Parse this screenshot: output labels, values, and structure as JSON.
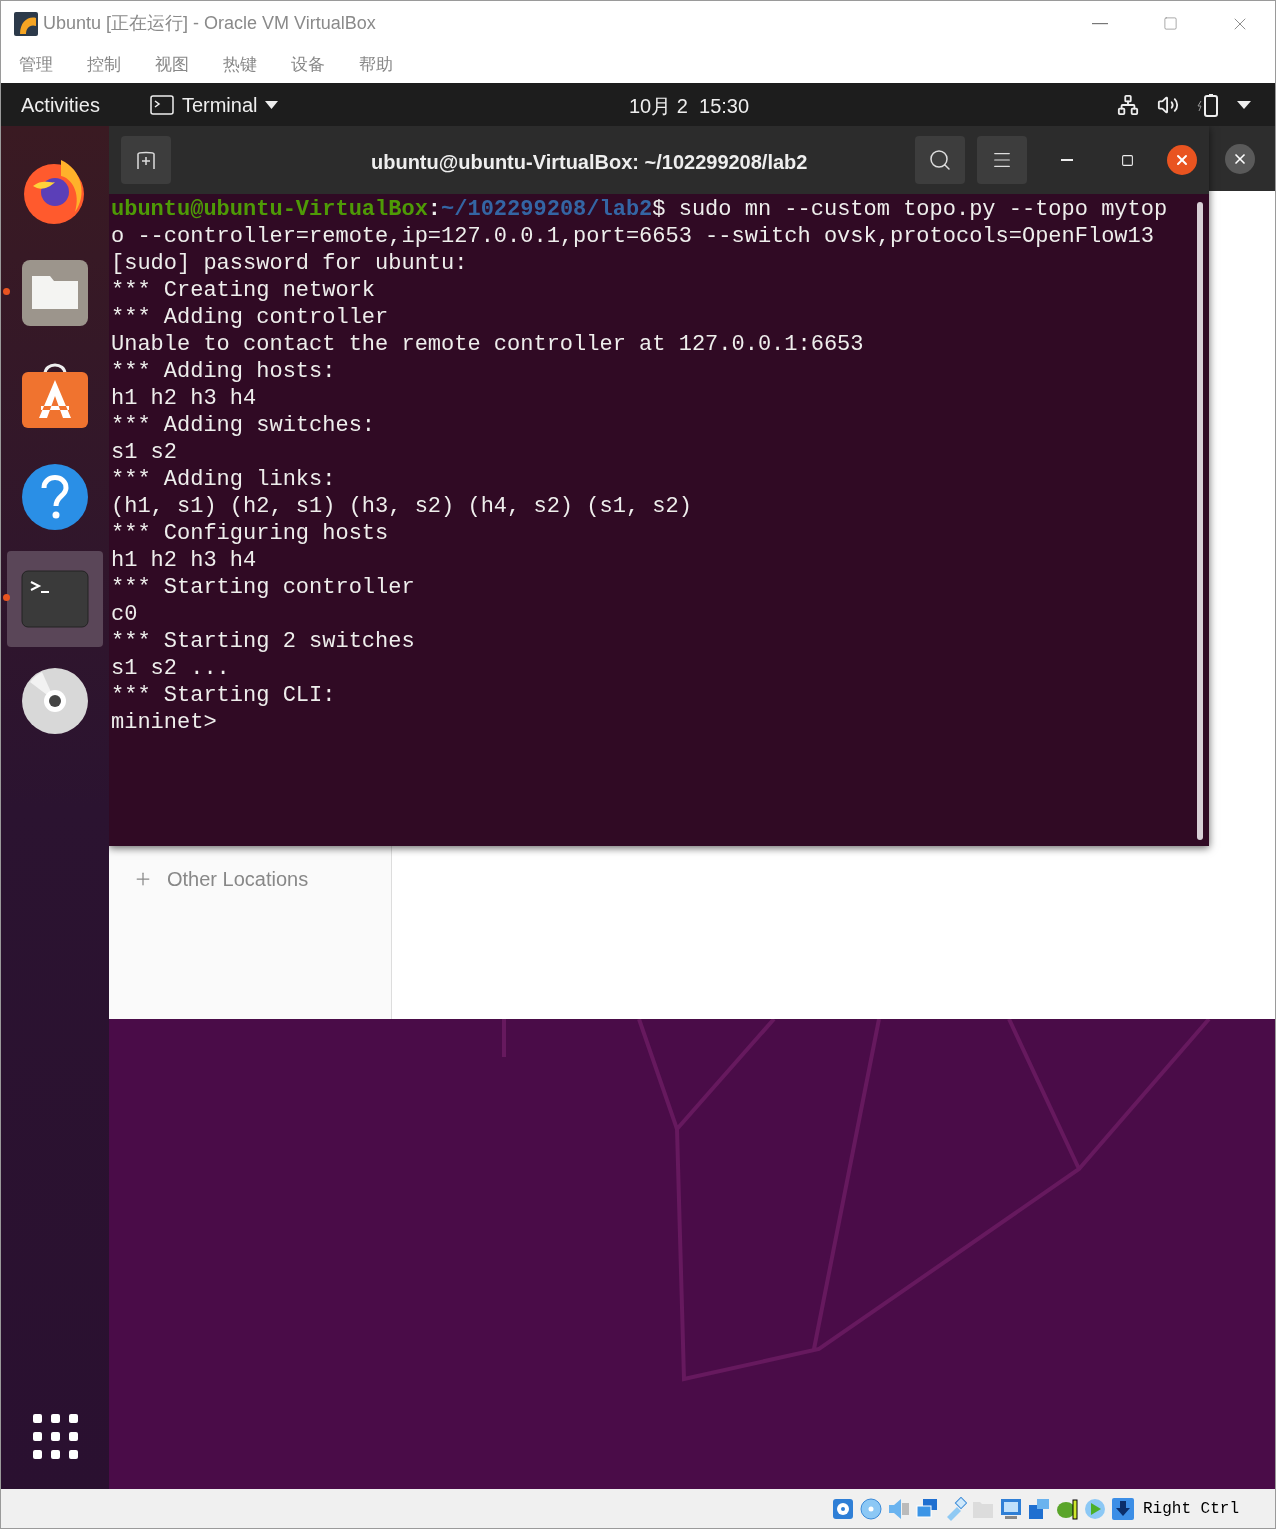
{
  "window": {
    "title": "Ubuntu [正在运行] - Oracle VM VirtualBox"
  },
  "menu": [
    "管理",
    "控制",
    "视图",
    "热键",
    "设备",
    "帮助"
  ],
  "top_bar": {
    "activities": "Activities",
    "app_menu": "Terminal",
    "clock": "10月 2  15:30"
  },
  "dock": [
    {
      "kind": "firefox",
      "running": false,
      "selected": false
    },
    {
      "kind": "files",
      "running": true,
      "selected": false
    },
    {
      "kind": "software",
      "running": false,
      "selected": false
    },
    {
      "kind": "help",
      "running": false,
      "selected": false
    },
    {
      "kind": "terminal",
      "running": true,
      "selected": true
    },
    {
      "kind": "disc",
      "running": false,
      "selected": false
    }
  ],
  "terminal": {
    "title": "ubuntu@ubuntu-VirtualBox: ~/102299208/lab2",
    "lines": [
      {
        "kind": "prompt",
        "user": "ubuntu@ubuntu-VirtualBox",
        "sep": ":",
        "path": "~/102299208/lab2",
        "command": "$ sudo mn --custom topo.py --topo mytop"
      },
      {
        "kind": "output",
        "text": "o --controller=remote,ip=127.0.0.1,port=6653 --switch ovsk,protocols=OpenFlow13"
      },
      {
        "kind": "output",
        "text": "[sudo] password for ubuntu:"
      },
      {
        "kind": "output",
        "text": "*** Creating network"
      },
      {
        "kind": "output",
        "text": "*** Adding controller"
      },
      {
        "kind": "output",
        "text": "Unable to contact the remote controller at 127.0.0.1:6653"
      },
      {
        "kind": "output",
        "text": "*** Adding hosts:"
      },
      {
        "kind": "output",
        "text": "h1 h2 h3 h4"
      },
      {
        "kind": "output",
        "text": "*** Adding switches:"
      },
      {
        "kind": "output",
        "text": "s1 s2"
      },
      {
        "kind": "output",
        "text": "*** Adding links:"
      },
      {
        "kind": "output",
        "text": "(h1, s1) (h2, s1) (h3, s2) (h4, s2) (s1, s2)"
      },
      {
        "kind": "output",
        "text": "*** Configuring hosts"
      },
      {
        "kind": "output",
        "text": "h1 h2 h3 h4"
      },
      {
        "kind": "output",
        "text": "*** Starting controller"
      },
      {
        "kind": "output",
        "text": "c0"
      },
      {
        "kind": "output",
        "text": "*** Starting 2 switches"
      },
      {
        "kind": "output",
        "text": "s1 s2 ..."
      },
      {
        "kind": "output",
        "text": "*** Starting CLI:"
      },
      {
        "kind": "output",
        "text": "mininet>"
      }
    ]
  },
  "files": {
    "sidebar": [
      {
        "label": "Other Locations"
      }
    ]
  },
  "status_bar": {
    "host_key": "Right Ctrl"
  }
}
